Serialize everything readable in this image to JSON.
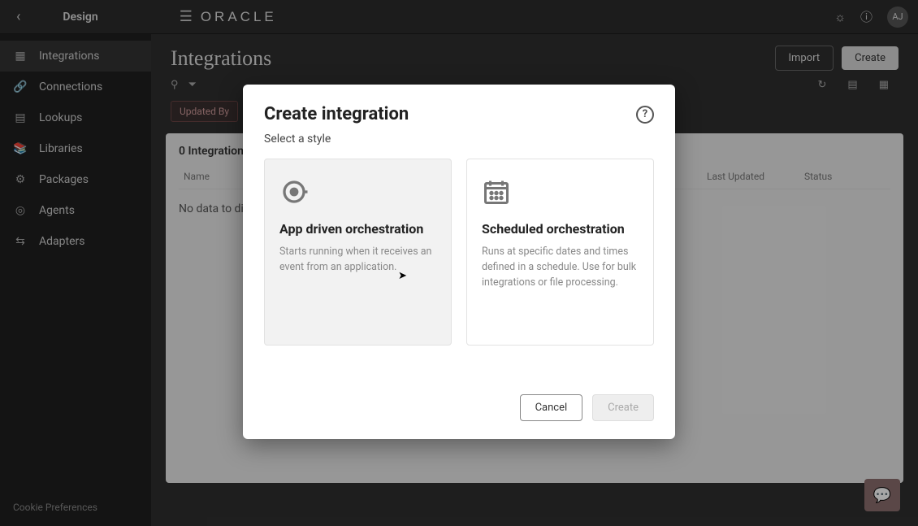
{
  "topbar": {
    "section": "Design",
    "brand": "ORACLE",
    "avatar_initials": "AJ"
  },
  "sidebar": {
    "items": [
      {
        "label": "Integrations"
      },
      {
        "label": "Connections"
      },
      {
        "label": "Lookups"
      },
      {
        "label": "Libraries"
      },
      {
        "label": "Packages"
      },
      {
        "label": "Agents"
      },
      {
        "label": "Adapters"
      }
    ],
    "footer": "Cookie Preferences"
  },
  "page": {
    "title": "Integrations",
    "import_btn": "Import",
    "create_btn": "Create",
    "filter_chip": "Updated By",
    "panel_title": "0 Integrations",
    "col_name": "Name",
    "col_updated": "Last Updated",
    "col_status": "Status",
    "empty": "No data to display."
  },
  "modal": {
    "title": "Create integration",
    "subtitle": "Select a style",
    "cards": [
      {
        "title": "App driven orchestration",
        "desc": "Starts running when it receives an event from an application."
      },
      {
        "title": "Scheduled orchestration",
        "desc": "Runs at specific dates and times defined in a schedule. Use for bulk integrations or file processing."
      }
    ],
    "cancel": "Cancel",
    "create": "Create"
  }
}
